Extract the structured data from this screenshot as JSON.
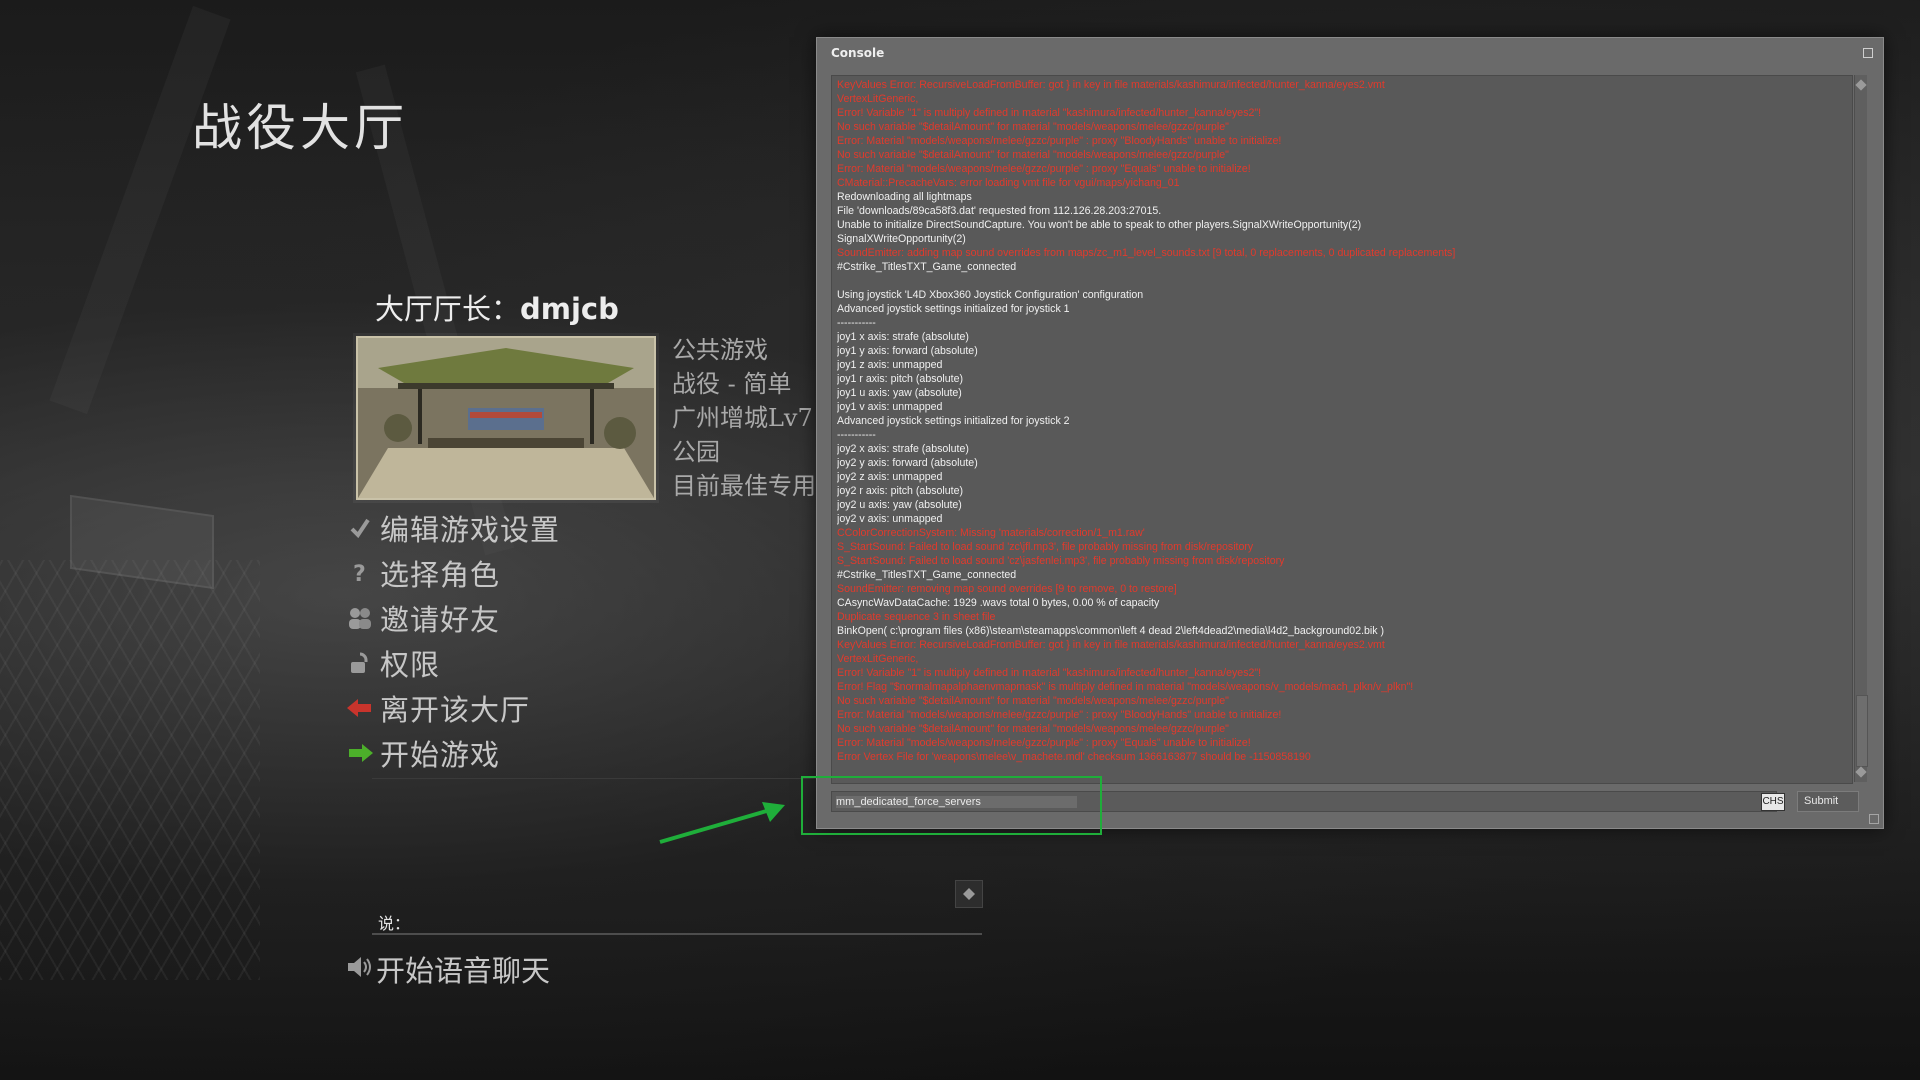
{
  "lobby": {
    "title": "战役大厅",
    "host_label": "大厅厅长：",
    "host_name": "dmjcb",
    "info": [
      "公共游戏",
      "战役 - 简单",
      "广州增城Lv7",
      "公园",
      "目前最佳专用"
    ]
  },
  "menu": {
    "items": [
      {
        "label": "编辑游戏设置",
        "icon": "checkmark-icon"
      },
      {
        "label": "选择角色",
        "icon": "question-icon"
      },
      {
        "label": "邀请好友",
        "icon": "friends-icon"
      },
      {
        "label": "权限",
        "icon": "lock-icon"
      },
      {
        "label": "离开该大厅",
        "icon": "exit-arrow-icon"
      },
      {
        "label": "开始游戏",
        "icon": "start-arrow-icon"
      }
    ]
  },
  "chat": {
    "say_label": "说：",
    "voice_label": "开始语音聊天"
  },
  "console": {
    "title": "Console",
    "input_value": "mm_dedicated_force_servers",
    "ime_badge": "CHS",
    "submit_label": "Submit",
    "lines": [
      {
        "text": "KeyValues Error: RecursiveLoadFromBuffer: got } in key in file materials/kashimura/infected/hunter_kanna/eyes2.vmt",
        "error": true
      },
      {
        "text": "VertexLitGeneric,",
        "error": true
      },
      {
        "text": "Error! Variable \"1\" is multiply defined in material \"kashimura/infected/hunter_kanna/eyes2\"!",
        "error": true
      },
      {
        "text": "No such variable \"$detailAmount\" for material \"models/weapons/melee/gzzc/purple\"",
        "error": true
      },
      {
        "text": "Error: Material \"models/weapons/melee/gzzc/purple\" : proxy \"BloodyHands\" unable to initialize!",
        "error": true
      },
      {
        "text": "No such variable \"$detailAmount\" for material \"models/weapons/melee/gzzc/purple\"",
        "error": true
      },
      {
        "text": "Error: Material \"models/weapons/melee/gzzc/purple\" : proxy \"Equals\" unable to initialize!",
        "error": true
      },
      {
        "text": "CMaterial::PrecacheVars: error loading vmt file for vgui/maps/yichang_01",
        "error": true
      },
      {
        "text": "Redownloading all lightmaps",
        "error": false
      },
      {
        "text": "File 'downloads/89ca58f3.dat' requested from 112.126.28.203:27015.",
        "error": false
      },
      {
        "text": "Unable to initialize DirectSoundCapture. You won't be able to speak to other players.SignalXWriteOpportunity(2)",
        "error": false
      },
      {
        "text": "SignalXWriteOpportunity(2)",
        "error": false
      },
      {
        "text": "SoundEmitter: adding map sound overrides from maps/zc_m1_level_sounds.txt [9 total, 0 replacements, 0 duplicated replacements]",
        "error": true
      },
      {
        "text": "#Cstrike_TitlesTXT_Game_connected",
        "error": false
      },
      {
        "text": "",
        "error": false
      },
      {
        "text": "Using joystick 'L4D Xbox360 Joystick Configuration' configuration",
        "error": false
      },
      {
        "text": "Advanced joystick settings initialized for joystick 1",
        "error": false
      },
      {
        "text": "-----------",
        "error": false
      },
      {
        "text": "joy1 x axis: strafe (absolute)",
        "error": false
      },
      {
        "text": "joy1 y axis: forward (absolute)",
        "error": false
      },
      {
        "text": "joy1 z axis: unmapped",
        "error": false
      },
      {
        "text": "joy1 r axis: pitch (absolute)",
        "error": false
      },
      {
        "text": "joy1 u axis: yaw (absolute)",
        "error": false
      },
      {
        "text": "joy1 v axis: unmapped",
        "error": false
      },
      {
        "text": "Advanced joystick settings initialized for joystick 2",
        "error": false
      },
      {
        "text": "-----------",
        "error": false
      },
      {
        "text": "joy2 x axis: strafe (absolute)",
        "error": false
      },
      {
        "text": "joy2 y axis: forward (absolute)",
        "error": false
      },
      {
        "text": "joy2 z axis: unmapped",
        "error": false
      },
      {
        "text": "joy2 r axis: pitch (absolute)",
        "error": false
      },
      {
        "text": "joy2 u axis: yaw (absolute)",
        "error": false
      },
      {
        "text": "joy2 v axis: unmapped",
        "error": false
      },
      {
        "text": "CColorCorrectionSystem: Missing 'materials/correction/1_m1.raw'",
        "error": true
      },
      {
        "text": "S_StartSound: Failed to load sound 'zc\\jfl.mp3', file probably missing from disk/repository",
        "error": true
      },
      {
        "text": "S_StartSound: Failed to load sound 'cz\\jasfenlei.mp3', file probably missing from disk/repository",
        "error": true
      },
      {
        "text": "#Cstrike_TitlesTXT_Game_connected",
        "error": false
      },
      {
        "text": "SoundEmitter: removing map sound overrides [9 to remove, 0 to restore]",
        "error": true
      },
      {
        "text": "CAsyncWavDataCache: 1929 .wavs total 0 bytes, 0.00 % of capacity",
        "error": false
      },
      {
        "text": "Duplicate sequence 3 in sheet file",
        "error": true
      },
      {
        "text": "BinkOpen( c:\\program files (x86)\\steam\\steamapps\\common\\left 4 dead 2\\left4dead2\\media\\l4d2_background02.bik )",
        "error": false
      },
      {
        "text": "KeyValues Error: RecursiveLoadFromBuffer: got } in key in file materials/kashimura/infected/hunter_kanna/eyes2.vmt",
        "error": true
      },
      {
        "text": "VertexLitGeneric,",
        "error": true
      },
      {
        "text": "Error! Variable \"1\" is multiply defined in material \"kashimura/infected/hunter_kanna/eyes2\"!",
        "error": true
      },
      {
        "text": "Error! Flag \"$normalmapalphaenvmapmask\" is multiply defined in material \"models/weapons/v_models/mach_plkn/v_plkn\"!",
        "error": true
      },
      {
        "text": "No such variable \"$detailAmount\" for material \"models/weapons/melee/gzzc/purple\"",
        "error": true
      },
      {
        "text": "Error: Material \"models/weapons/melee/gzzc/purple\" : proxy \"BloodyHands\" unable to initialize!",
        "error": true
      },
      {
        "text": "No such variable \"$detailAmount\" for material \"models/weapons/melee/gzzc/purple\"",
        "error": true
      },
      {
        "text": "Error: Material \"models/weapons/melee/gzzc/purple\" : proxy \"Equals\" unable to initialize!",
        "error": true
      },
      {
        "text": "Error Vertex File for 'weapons\\melee\\v_machete.mdl' checksum 1366163877 should be -1150858190",
        "error": true
      }
    ]
  },
  "annotation": {
    "highlight_color": "#1fae3a"
  },
  "colors": {
    "error_text": "#e23a2c",
    "normal_text": "#f0f0f0",
    "console_bg": "#6a6a6a"
  }
}
